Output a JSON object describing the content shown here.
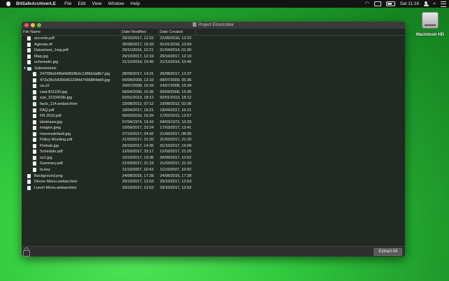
{
  "menubar": {
    "app_name": "BitSafeArchiverLE",
    "items": [
      "File",
      "Edit",
      "View",
      "Window",
      "Help"
    ],
    "clock": "Sat 11:16"
  },
  "desktop": {
    "drive_label": "Macintosh HD"
  },
  "window": {
    "title": "Project Elrond.bitar",
    "columns": {
      "name": "File Name",
      "modified": "Date Modified",
      "created": "Date Created"
    },
    "extract_label": "Extract All"
  },
  "files": [
    {
      "name": "accords.pdf",
      "modified": "29/10/2017, 12:22",
      "created": "22/06/2016, 12:22",
      "level": 0,
      "icon": "document-icon"
    },
    {
      "name": "Agenda.rtf",
      "modified": "26/08/2017, 16:33",
      "created": "01/01/2016, 10:04",
      "level": 0,
      "icon": "document-icon"
    },
    {
      "name": "Datasheet_1mg.pdf",
      "modified": "29/11/2016, 12:21",
      "created": "01/04/2014, 01:00",
      "level": 0,
      "icon": "document-icon"
    },
    {
      "name": "Map.jpg",
      "modified": "29/10/2017, 12:19",
      "created": "29/10/2017, 12:19",
      "level": 0,
      "icon": "document-icon"
    },
    {
      "name": "schematic.jpg",
      "modified": "21/12/2014, 10:45",
      "created": "21/12/2014, 10:45",
      "level": 0,
      "icon": "document-icon"
    },
    {
      "name": "Submissions",
      "modified": "",
      "created": "",
      "level": 0,
      "icon": "folder-icon",
      "folder": true
    },
    {
      "name": "247f38e54f9d46800fb2c1385b3a8b7.jpg",
      "modified": "28/09/2017, 14:31",
      "created": "26/08/2017, 12:37",
      "level": 1,
      "icon": "document-icon"
    },
    {
      "name": "472e35c5435646223f4d7456884dd9.jpg",
      "modified": "09/09/2009, 12:10",
      "created": "08/07/2009, 05:36",
      "level": 1,
      "icon": "document-icon"
    },
    {
      "name": "ca.crt",
      "modified": "24/07/2008, 15:34",
      "created": "24/07/2008, 15:34",
      "level": 1,
      "icon": "document-icon"
    },
    {
      "name": "cast-811100.jpg",
      "modified": "09/04/2006, 15:36",
      "created": "09/04/2006, 15:36",
      "level": 1,
      "icon": "document-icon"
    },
    {
      "name": "eye_3133429b.jpg",
      "modified": "02/01/2013, 18:12",
      "created": "02/01/2013, 18:12",
      "level": 1,
      "icon": "document-icon"
    },
    {
      "name": "facts_114.webarchive",
      "modified": "23/08/2012, 07:12",
      "created": "19/08/2012, 03:36",
      "level": 1,
      "icon": "webarchive-icon"
    },
    {
      "name": "FAQ.pdf",
      "modified": "18/04/2017, 16:21",
      "created": "18/04/2017, 16:21",
      "level": 1,
      "icon": "document-icon"
    },
    {
      "name": "FN 2010.pdf",
      "modified": "09/03/2016, 15:34",
      "created": "17/02/2012, 12:57",
      "level": 1,
      "icon": "document-icon"
    },
    {
      "name": "ialotriasw.jpg",
      "modified": "07/04/1974, 19:16",
      "created": "04/03/1972, 10:33",
      "level": 1,
      "icon": "document-icon"
    },
    {
      "name": "images.jpeg",
      "modified": "19/09/2017, 23:24",
      "created": "17/03/2017, 13:41",
      "level": 1,
      "icon": "document-icon"
    },
    {
      "name": "maxresdefault.jpg",
      "modified": "27/10/2017, 04:42",
      "created": "21/06/2017, 08:36",
      "level": 1,
      "icon": "document-icon"
    },
    {
      "name": "Policy Wording.pdf",
      "modified": "21/03/2017, 21:20",
      "created": "21/03/2017, 21:20",
      "level": 1,
      "icon": "document-icon"
    },
    {
      "name": "Portrait.jpg",
      "modified": "29/10/2017, 14:35",
      "created": "01/10/2017, 16:09",
      "level": 1,
      "icon": "document-icon"
    },
    {
      "name": "Schedule.pdf",
      "modified": "12/03/2017, 23:17",
      "created": "12/03/2017, 21:25",
      "level": 1,
      "icon": "document-icon"
    },
    {
      "name": "ss1.jpg",
      "modified": "19/10/2017, 19:36",
      "created": "30/09/2017, 10:52",
      "level": 1,
      "icon": "document-icon"
    },
    {
      "name": "Summary.pdf",
      "modified": "21/03/2017, 21:19",
      "created": "21/03/2017, 21:19",
      "level": 1,
      "icon": "document-icon"
    },
    {
      "name": "ta.key",
      "modified": "11/10/2007, 10:43",
      "created": "11/10/2007, 10:43",
      "level": 1,
      "icon": "document-icon"
    },
    {
      "name": "Background.png",
      "modified": "24/08/2016, 17:28",
      "created": "24/08/2016, 17:28",
      "level": 0,
      "icon": "document-icon"
    },
    {
      "name": "Dinner Menu.webarchive",
      "modified": "29/10/2017, 12:53",
      "created": "29/10/2017, 12:53",
      "level": 0,
      "icon": "webarchive-icon"
    },
    {
      "name": "Lunch Menu.webarchive",
      "modified": "29/10/2017, 12:52",
      "created": "29/10/2017, 12:52",
      "level": 0,
      "icon": "webarchive-icon"
    }
  ]
}
